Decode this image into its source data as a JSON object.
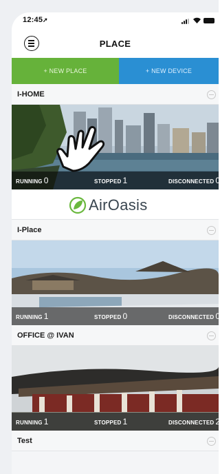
{
  "status_bar": {
    "time": "12:45"
  },
  "header": {
    "title": "PLACE",
    "menu_icon": "menu-icon"
  },
  "actions": {
    "new_place": "+ NEW PLACE",
    "new_device": "+ NEW DEVICE",
    "place_color": "#66b23a",
    "device_color": "#2a8fd3"
  },
  "stat_labels": {
    "running": "RUNNING",
    "stopped": "STOPPED",
    "disconnected": "DISCONNECTED"
  },
  "places": [
    {
      "name": "I-HOME",
      "running": "0",
      "stopped": "1",
      "disconnected": "0"
    },
    {
      "name": "I-Place",
      "running": "1",
      "stopped": "0",
      "disconnected": "0"
    },
    {
      "name": "OFFICE @ IVAN",
      "running": "1",
      "stopped": "1",
      "disconnected": "2"
    },
    {
      "name": "Test"
    }
  ],
  "brand": {
    "name": "AirOasis"
  }
}
